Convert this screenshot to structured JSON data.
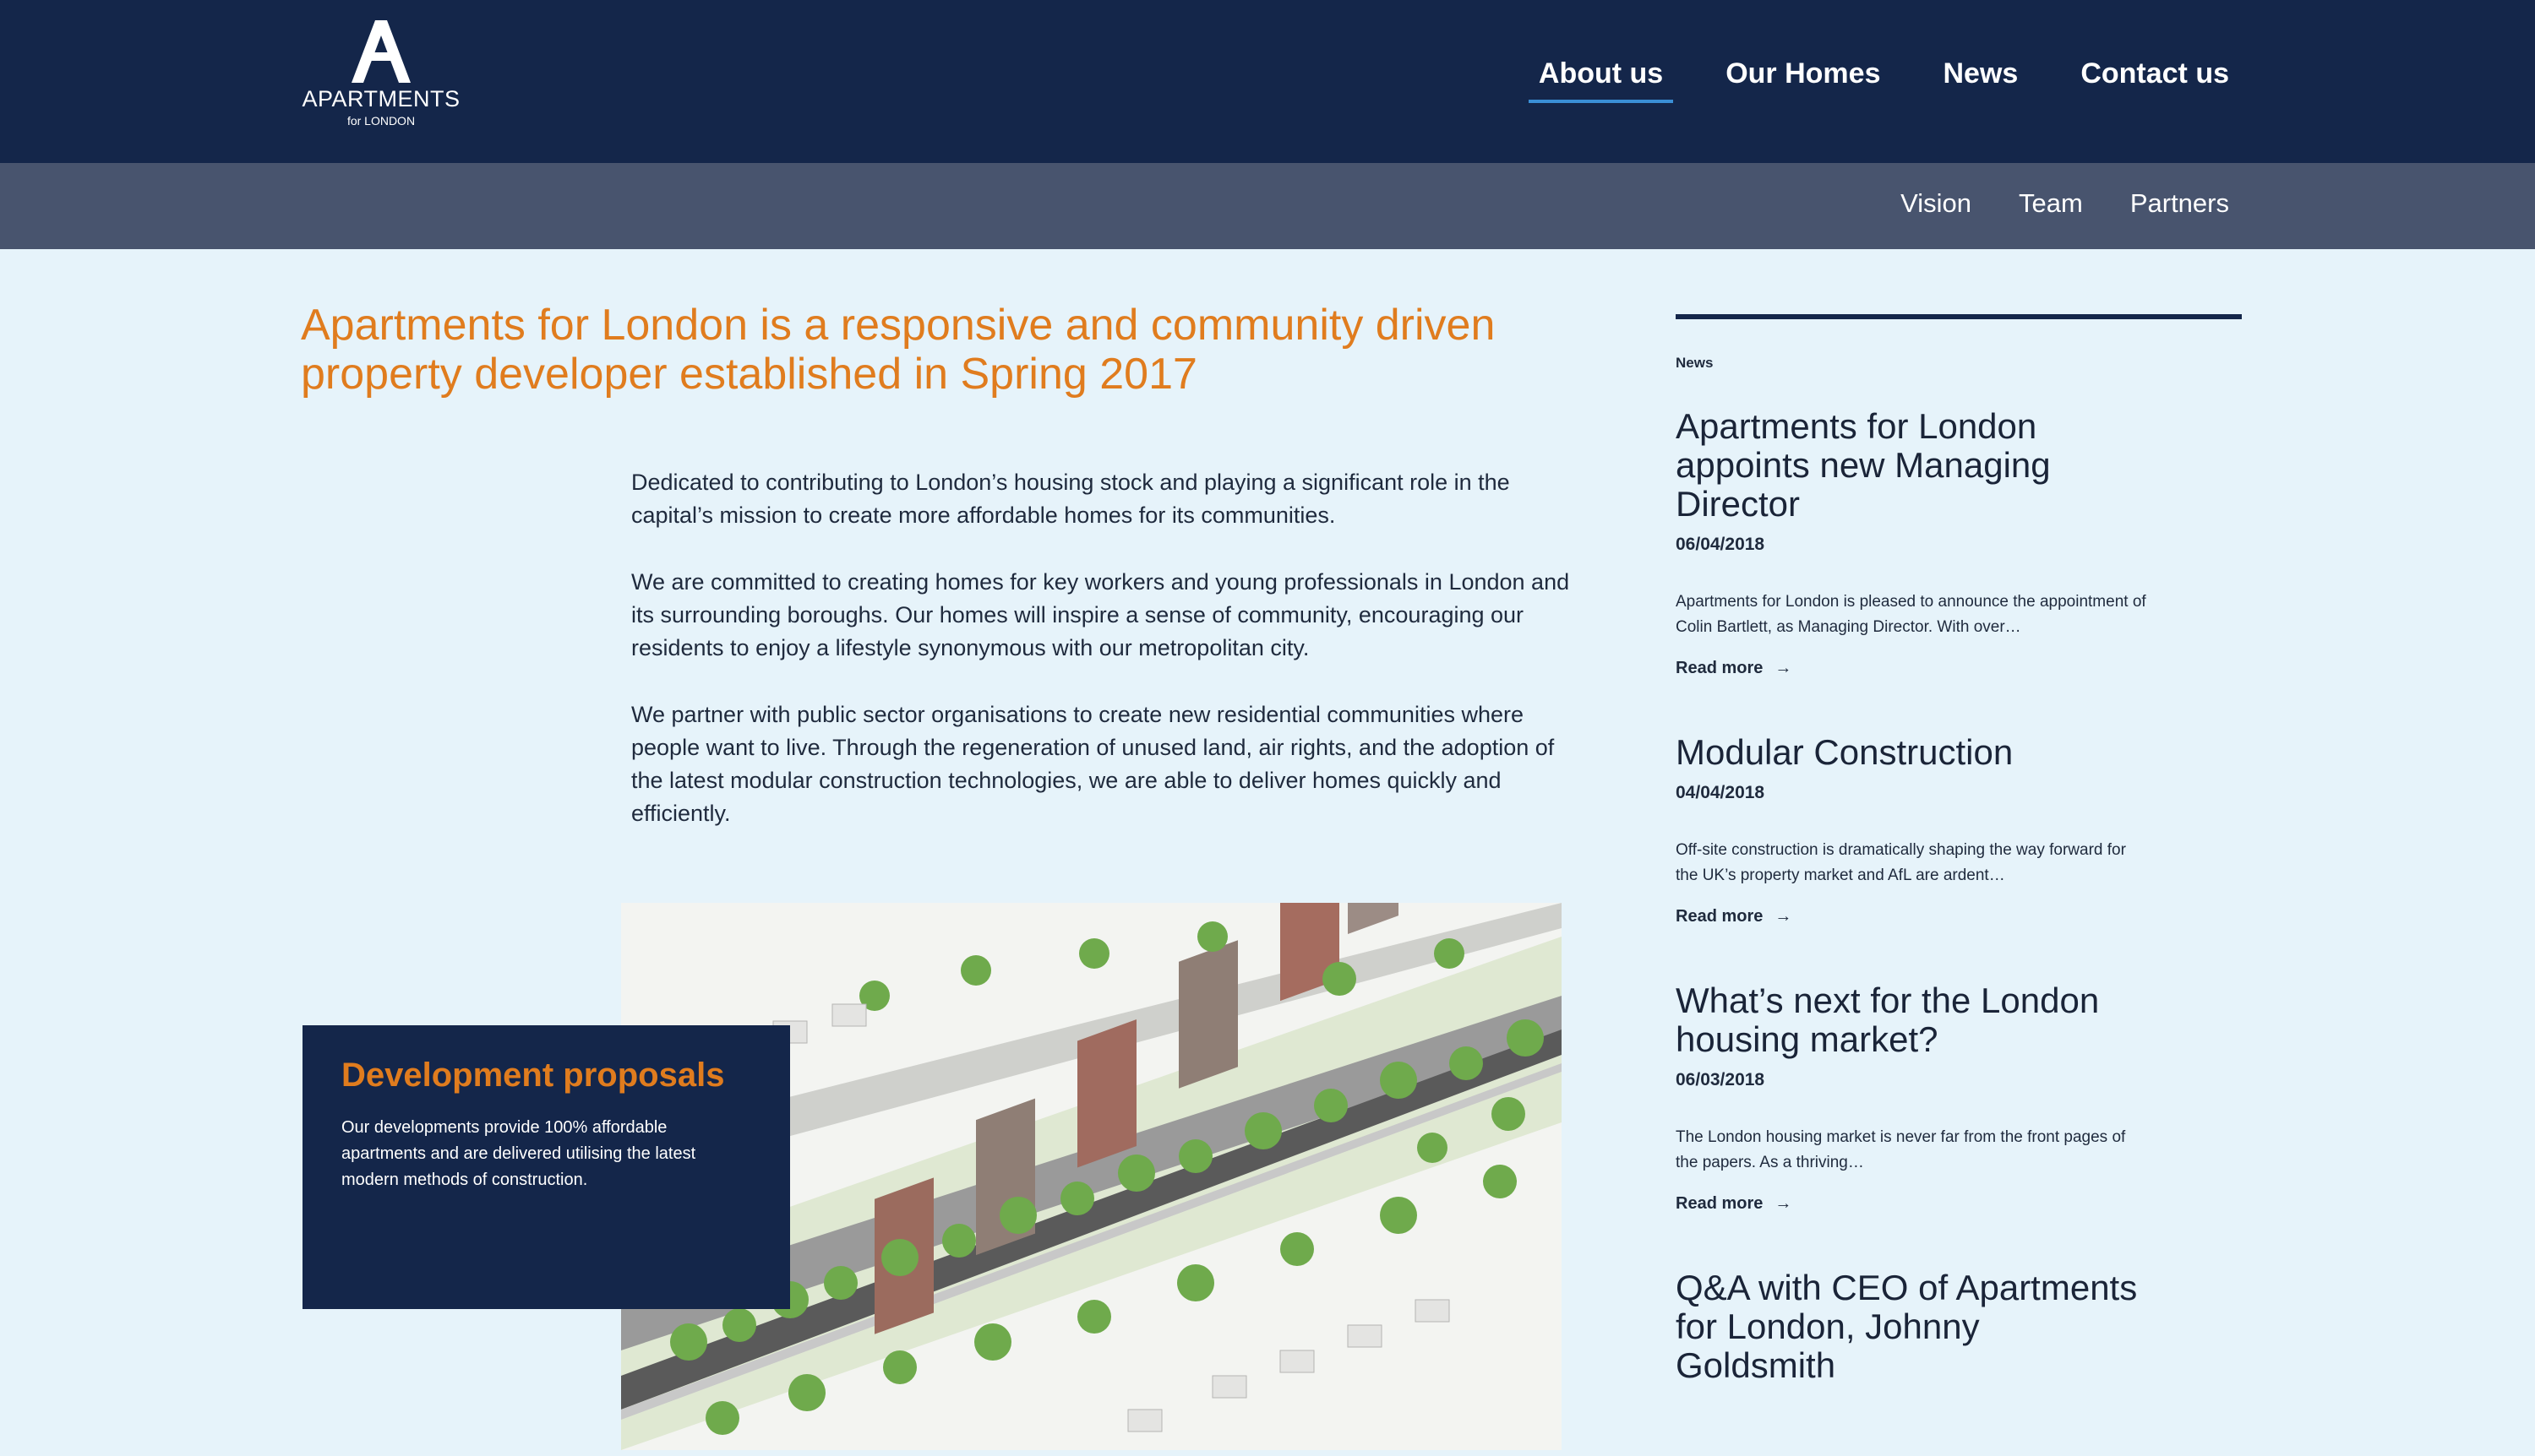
{
  "logo": {
    "main": "APARTMENTS",
    "sub": "for LONDON"
  },
  "nav": {
    "items": [
      {
        "label": "About us",
        "active": true
      },
      {
        "label": "Our Homes",
        "active": false
      },
      {
        "label": "News",
        "active": false
      },
      {
        "label": "Contact us",
        "active": false
      }
    ]
  },
  "subnav": {
    "items": [
      {
        "label": "Vision"
      },
      {
        "label": "Team"
      },
      {
        "label": "Partners"
      }
    ]
  },
  "main": {
    "headline": "Apartments for London is a responsive and community driven property developer established in Spring 2017",
    "paragraphs": [
      "Dedicated to contributing to London’s housing stock and playing a significant role in the capital’s mission to create more affordable homes for its communities.",
      "We are committed to creating homes for key workers and young professionals in London and its surrounding boroughs. Our homes will inspire a sense of community, encouraging our residents to enjoy a lifestyle synonymous with our metropolitan city.",
      "We partner with public sector organisations to create new residential communities where people want to live. Through the regeneration of unused land, air rights, and the adoption of the latest modular construction technologies, we are able to deliver homes quickly and efficiently."
    ],
    "dev_card": {
      "title": "Development proposals",
      "text": "Our developments provide 100% affordable apartments and are delivered utilising the latest modern methods of construction."
    }
  },
  "sidebar": {
    "label": "News",
    "read_more": "Read more",
    "items": [
      {
        "title": "Apartments for London appoints new Managing Director",
        "date": "06/04/2018",
        "excerpt": "Apartments for London is pleased to announce the appointment of Colin Bartlett, as Managing Director. With over…"
      },
      {
        "title": "Modular Construction",
        "date": "04/04/2018",
        "excerpt": "Off-site construction is dramatically shaping the way forward for the UK’s property market and AfL are ardent…"
      },
      {
        "title": "What’s next for the London housing market?",
        "date": "06/03/2018",
        "excerpt": "The London housing market is never far from the front pages of the papers. As a thriving…"
      },
      {
        "title": "Q&A with CEO of Apartments for London, Johnny Goldsmith",
        "date": "",
        "excerpt": ""
      }
    ]
  },
  "colors": {
    "navy": "#14264a",
    "slate": "#48546e",
    "accent_orange": "#e07c1e",
    "background": "#e6f3fa",
    "active_underline": "#3a8fd6"
  }
}
